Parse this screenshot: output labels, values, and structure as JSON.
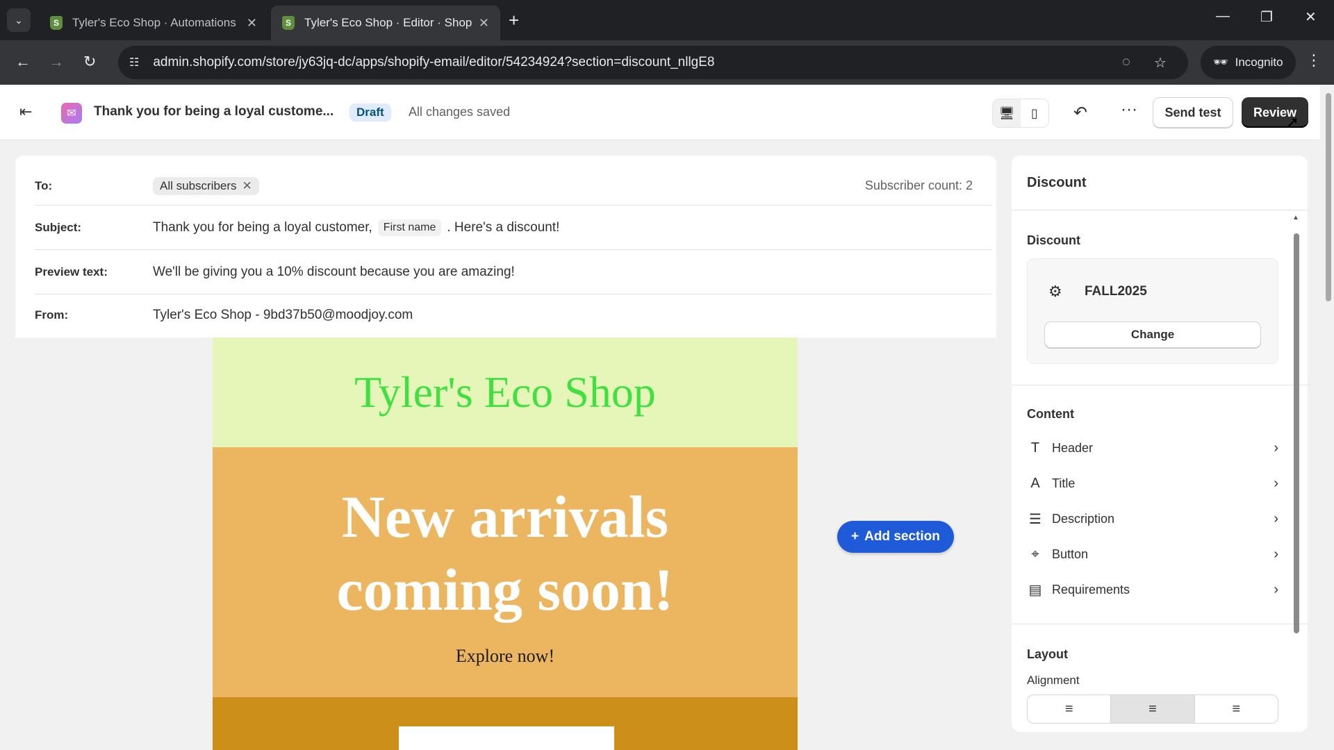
{
  "browser": {
    "tabs": [
      {
        "title": "Tyler's Eco Shop · Automations",
        "active": false
      },
      {
        "title": "Tyler's Eco Shop · Editor · Shopify",
        "active": true
      }
    ],
    "url": "admin.shopify.com/store/jy63jq-dc/apps/shopify-email/editor/54234924?section=discount_nllgE8",
    "incognito_label": "Incognito"
  },
  "header": {
    "title": "Thank you for being a loyal custome...",
    "status_badge": "Draft",
    "save_status": "All changes saved",
    "send_test_label": "Send test",
    "review_label": "Review"
  },
  "meta": {
    "to_label": "To:",
    "to_chip": "All subscribers",
    "subscriber_count": "Subscriber count: 2",
    "subject_label": "Subject:",
    "subject_before": "Thank you for being a loyal customer,",
    "subject_tag": "First name",
    "subject_after": ". Here's a discount!",
    "preview_label": "Preview text:",
    "preview_text": "We'll be giving you a 10% discount because you are amazing!",
    "from_label": "From:",
    "from_value": "Tyler's Eco Shop - 9bd37b50@moodjoy.com"
  },
  "email": {
    "shop_name": "Tyler's Eco Shop",
    "hero_line1": "New arrivals",
    "hero_line2": "coming soon!",
    "hero_sub": "Explore now!",
    "colors": {
      "header_bg": "#e6f6b8",
      "shop_name": "#3fe040",
      "hero_bg": "#ecb660",
      "product_bg": "#cc901a"
    }
  },
  "add_section_label": "Add section",
  "panel": {
    "title": "Discount",
    "discount_section": "Discount",
    "discount_code": "FALL2025",
    "change_label": "Change",
    "content_section": "Content",
    "content_items": [
      {
        "label": "Header",
        "icon": "text-icon"
      },
      {
        "label": "Title",
        "icon": "title-icon"
      },
      {
        "label": "Description",
        "icon": "description-icon"
      },
      {
        "label": "Button",
        "icon": "button-icon"
      },
      {
        "label": "Requirements",
        "icon": "requirements-icon"
      }
    ],
    "layout_section": "Layout",
    "alignment_label": "Alignment",
    "alignment_selected": "center"
  }
}
